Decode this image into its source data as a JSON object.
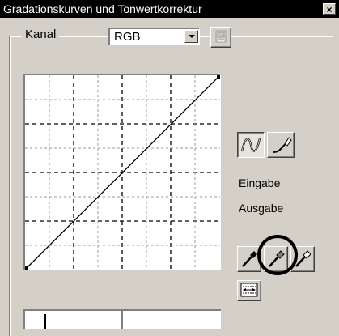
{
  "window": {
    "title": "Gradationskurven und Tonwertkorrektur",
    "close_glyph": "×"
  },
  "channel": {
    "label": "Kanal",
    "selected": "RGB"
  },
  "curve": {
    "input_label": "Eingabe",
    "output_label": "Ausgabe"
  },
  "icons": {
    "channel_extra": "picture-button-icon",
    "curve_mode": "smooth-curve-icon",
    "freehand_mode": "freehand-pencil-icon",
    "black_point": "black-eyedropper-icon",
    "gray_point": "gray-eyedropper-icon",
    "white_point": "white-eyedropper-icon",
    "auto_levels": "auto-range-icon"
  },
  "highlight_color": "#000000"
}
